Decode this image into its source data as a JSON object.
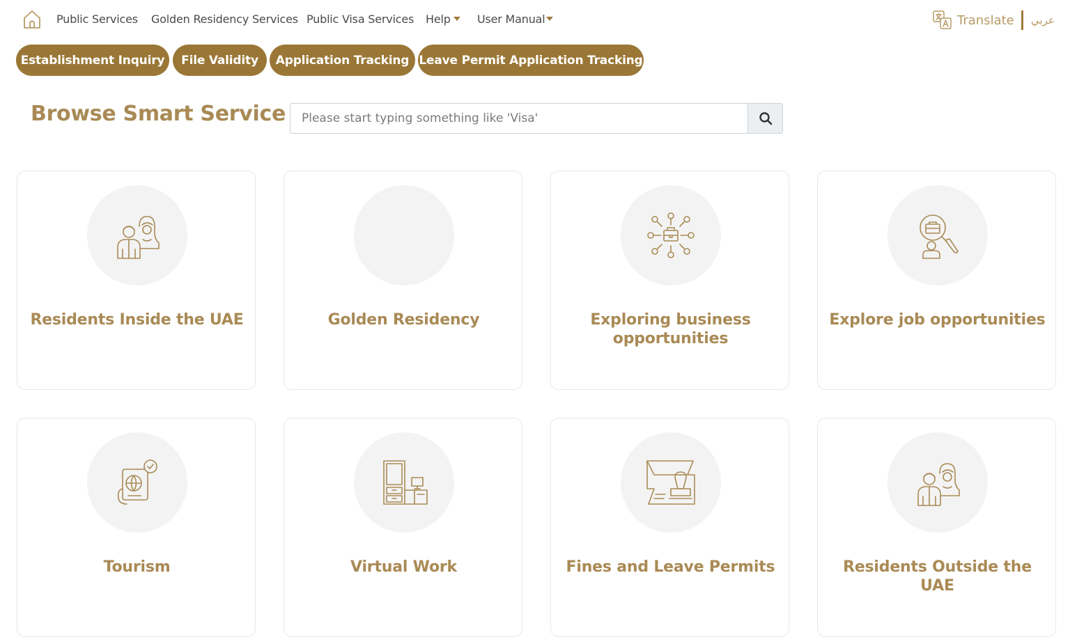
{
  "nav": {
    "items": [
      {
        "label": "Public Services"
      },
      {
        "label": "Golden Residency Services"
      },
      {
        "label": "Public Visa Services"
      },
      {
        "label": "Help"
      },
      {
        "label": "User Manual"
      }
    ],
    "translate_label": "Translate",
    "arabic_label": "عربي"
  },
  "quick_links": [
    {
      "label": "Establishment Inquiry"
    },
    {
      "label": "File Validity"
    },
    {
      "label": "Application Tracking"
    },
    {
      "label": "Leave Permit Application Tracking"
    }
  ],
  "browse": {
    "title": "Browse Smart Service",
    "search_placeholder": "Please start typing something like 'Visa'"
  },
  "cards": [
    {
      "title": "Residents Inside the UAE",
      "icon": "people-icon"
    },
    {
      "title": "Golden Residency",
      "icon": ""
    },
    {
      "title": "Exploring business opportunities",
      "icon": "business-network-icon"
    },
    {
      "title": "Explore job opportunities",
      "icon": "job-search-icon"
    },
    {
      "title": "Tourism",
      "icon": "passport-globe-icon"
    },
    {
      "title": "Virtual Work",
      "icon": "office-desk-icon"
    },
    {
      "title": "Fines and Leave Permits",
      "icon": "stamp-document-icon"
    },
    {
      "title": "Residents Outside the UAE",
      "icon": "people-icon"
    }
  ],
  "colors": {
    "accent": "#9a7736",
    "accent_text": "#a98a55",
    "card_circle": "#f3f3f3"
  }
}
